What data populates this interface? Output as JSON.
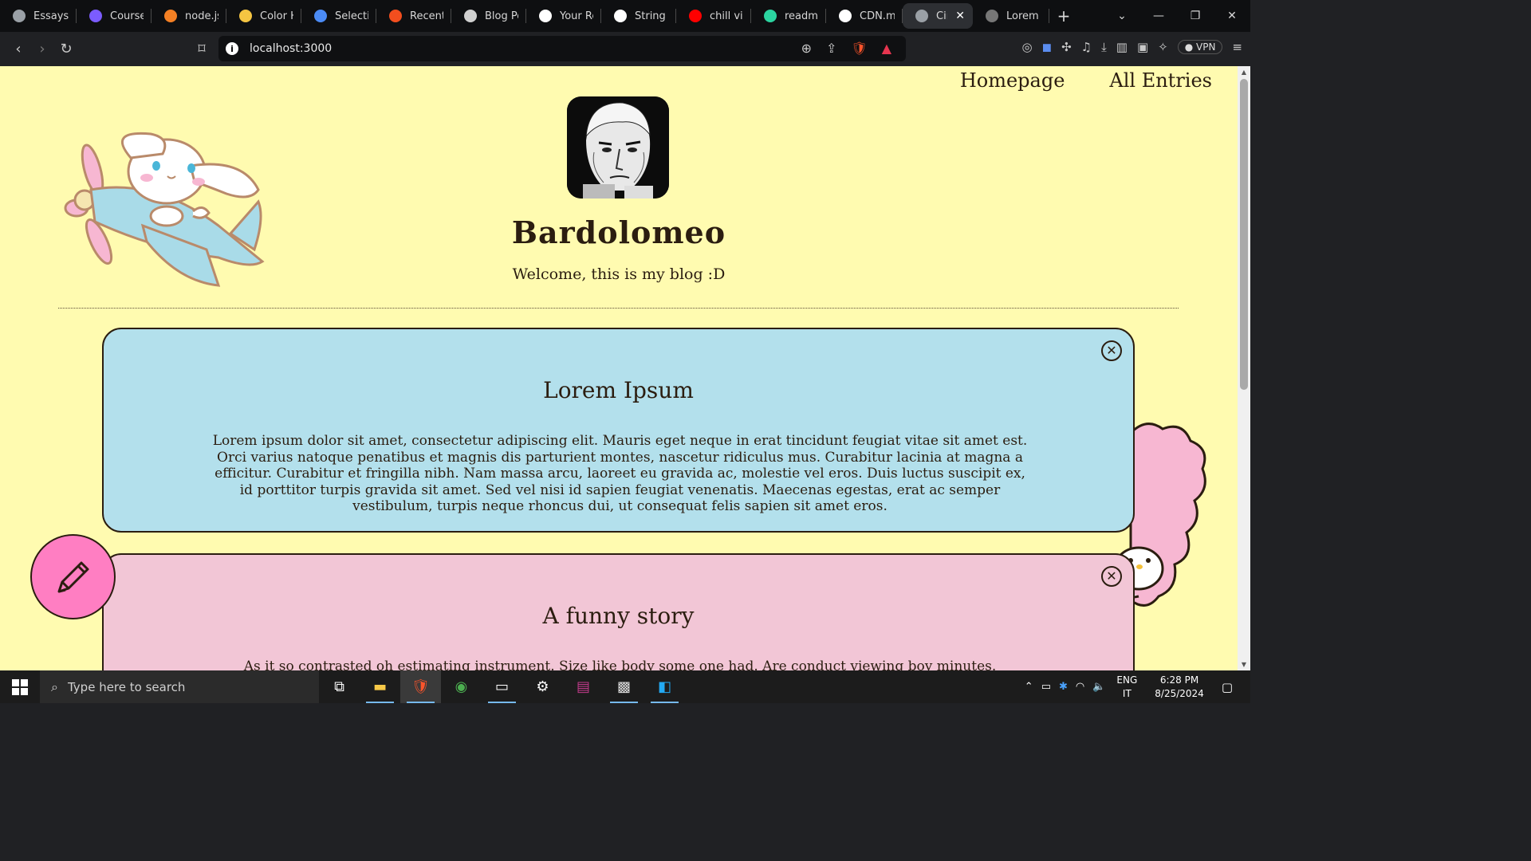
{
  "browser": {
    "tabs": [
      {
        "label": "Essays",
        "icon": "globe-icon",
        "color": "#9aa0a6"
      },
      {
        "label": "Course:",
        "icon": "course-icon",
        "color": "#7b5cff"
      },
      {
        "label": "node.js",
        "icon": "stackoverflow-icon",
        "color": "#f48024"
      },
      {
        "label": "Color H",
        "icon": "color-icon",
        "color": "#f5c542"
      },
      {
        "label": "Selectio",
        "icon": "selection-icon",
        "color": "#4b8bf5"
      },
      {
        "label": "Recents",
        "icon": "figma-icon",
        "color": "#f24e1e"
      },
      {
        "label": "Blog Po",
        "icon": "blog-icon",
        "color": "#d0d0d0"
      },
      {
        "label": "Your Re",
        "icon": "github-icon",
        "color": "#ffffff"
      },
      {
        "label": "String -",
        "icon": "mdn-icon",
        "color": "#ffffff"
      },
      {
        "label": "chill vid",
        "icon": "youtube-icon",
        "color": "#ff0000"
      },
      {
        "label": "readme.",
        "icon": "readme-icon",
        "color": "#2bd4a0"
      },
      {
        "label": "CDN.mc",
        "icon": "github-icon",
        "color": "#ffffff"
      },
      {
        "label": "Cin",
        "icon": "globe-icon",
        "color": "#9aa0a6",
        "active": true
      },
      {
        "label": "Lorem Ip",
        "icon": "lorem-icon",
        "color": "#777777"
      }
    ],
    "url": "localhost:3000",
    "vpn_label": "VPN"
  },
  "page": {
    "nav": {
      "homepage": "Homepage",
      "all_entries": "All Entries"
    },
    "title": "Bardolomeo",
    "tagline": "Welcome, this is my blog :D",
    "entries": [
      {
        "title": "Lorem Ipsum",
        "body": "Lorem ipsum dolor sit amet, consectetur adipiscing elit. Mauris eget neque in erat tincidunt feugiat vitae sit amet est. Orci varius natoque penatibus et magnis dis parturient montes, nascetur ridiculus mus. Curabitur lacinia at magna a efficitur. Curabitur et fringilla nibh. Nam massa arcu, laoreet eu gravida ac, molestie vel eros. Duis luctus suscipit ex, id porttitor turpis gravida sit amet. Sed vel nisi id sapien feugiat venenatis. Maecenas egestas, erat ac semper vestibulum, turpis neque rhoncus dui, ut consequat felis sapien sit amet eros.",
        "color": "#b3e0ec"
      },
      {
        "title": "A funny story",
        "body": "As it so contrasted oh estimating instrument. Size like body some one had. Are conduct viewing boy minutes.",
        "color": "#f2c6d6"
      }
    ],
    "colors": {
      "background": "#fffbb0",
      "text": "#2b1d10",
      "fab": "#ff7ec2"
    }
  },
  "taskbar": {
    "search_placeholder": "Type here to search",
    "lang_1": "ENG",
    "lang_2": "IT",
    "time": "6:28 PM",
    "date": "8/25/2024"
  }
}
